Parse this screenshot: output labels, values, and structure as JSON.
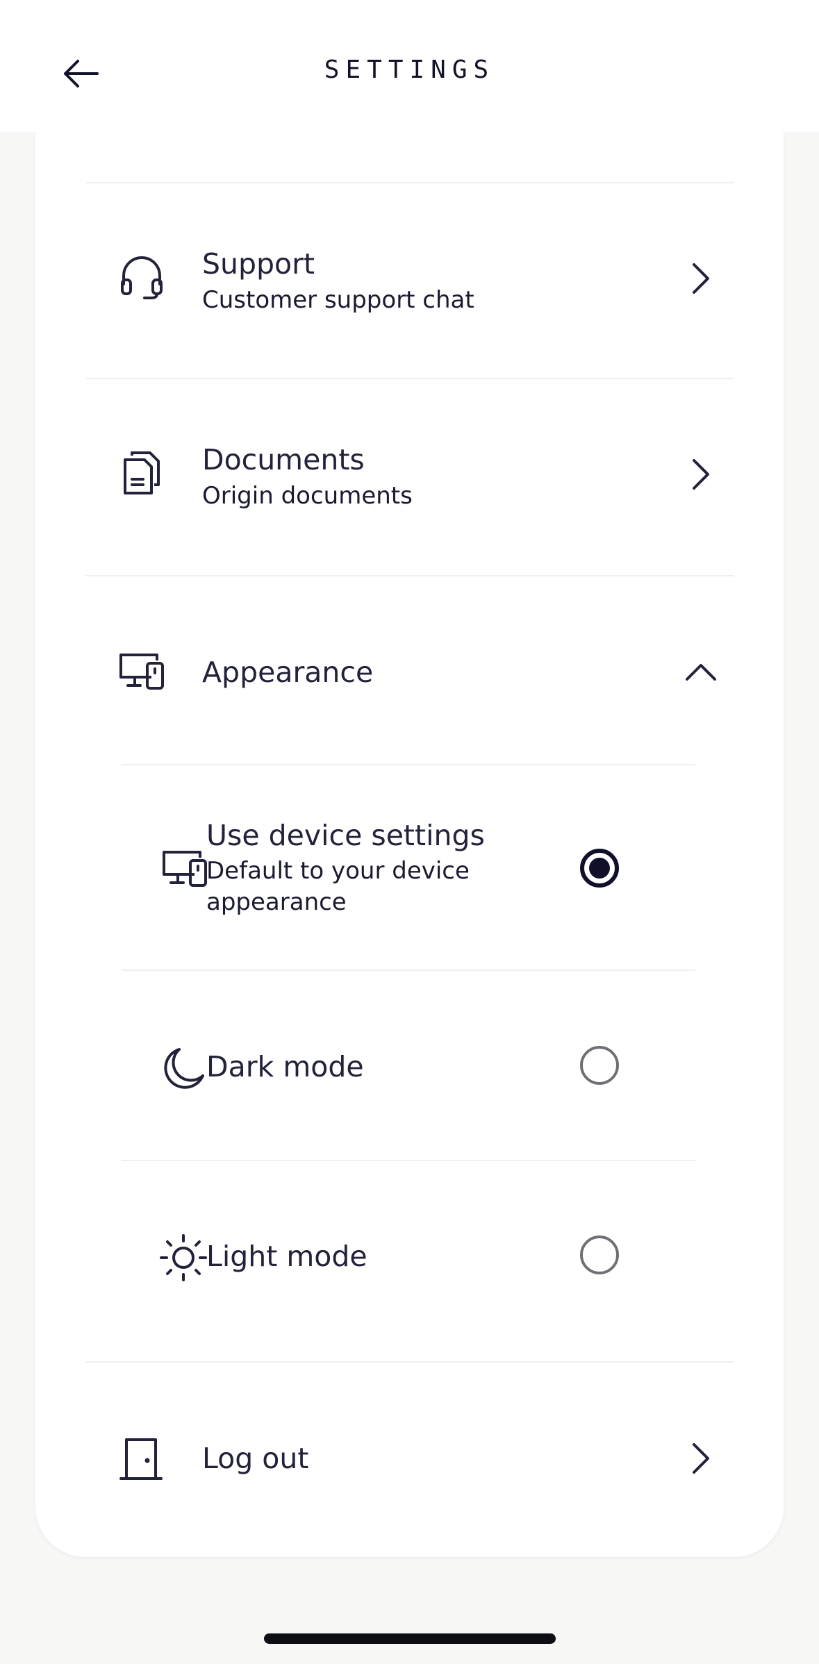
{
  "header": {
    "title": "SETTINGS",
    "back_icon": "arrow-left-icon"
  },
  "menu": {
    "support": {
      "title": "Support",
      "subtitle": "Customer support chat",
      "icon": "headset-icon"
    },
    "documents": {
      "title": "Documents",
      "subtitle": "Origin documents",
      "icon": "documents-icon"
    },
    "appearance": {
      "title": "Appearance",
      "icon": "devices-icon",
      "expanded": true,
      "options": [
        {
          "title": "Use device settings",
          "subtitle": "Default to your device appearance",
          "icon": "devices-icon",
          "selected": true
        },
        {
          "title": "Dark mode",
          "icon": "moon-icon",
          "selected": false
        },
        {
          "title": "Light mode",
          "icon": "sun-icon",
          "selected": false
        }
      ]
    },
    "logout": {
      "title": "Log out",
      "icon": "door-icon"
    }
  },
  "colors": {
    "text": "#1a1a2e",
    "background": "#f7f7f6",
    "card": "#ffffff",
    "radio_selected": "#10102a",
    "radio_unselected": "#6f6f75"
  }
}
